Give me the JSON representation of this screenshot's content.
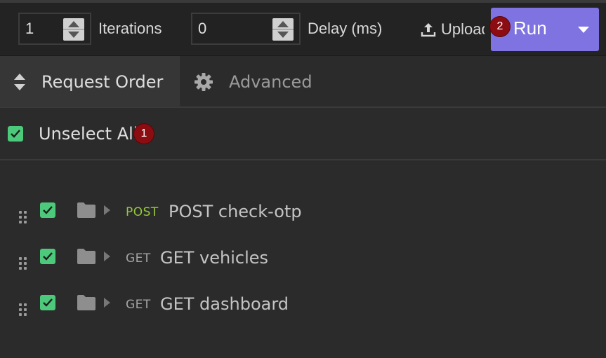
{
  "toolbar": {
    "iterations_value": "1",
    "iterations_label": "Iterations",
    "delay_value": "0",
    "delay_label": "Delay (ms)",
    "upload_label": "Upload",
    "run_label": "Run",
    "run_color": "#7e73e0"
  },
  "tabs": [
    {
      "label": "Request Order",
      "icon": "sort-icon",
      "active": true
    },
    {
      "label": "Advanced",
      "icon": "gear-icon",
      "active": false
    }
  ],
  "select_all": {
    "label": "Unselect All",
    "checked": true
  },
  "requests": [
    {
      "method": "POST",
      "name": "POST check-otp",
      "checked": true
    },
    {
      "method": "GET",
      "name": "GET vehicles",
      "checked": true
    },
    {
      "method": "GET",
      "name": "GET dashboard",
      "checked": true
    }
  ],
  "badges": [
    "1",
    "2"
  ],
  "colors": {
    "checkbox": "#4cc97a",
    "post": "#94c83c",
    "get": "#a4a4a4",
    "badge": "#8b0d12"
  }
}
